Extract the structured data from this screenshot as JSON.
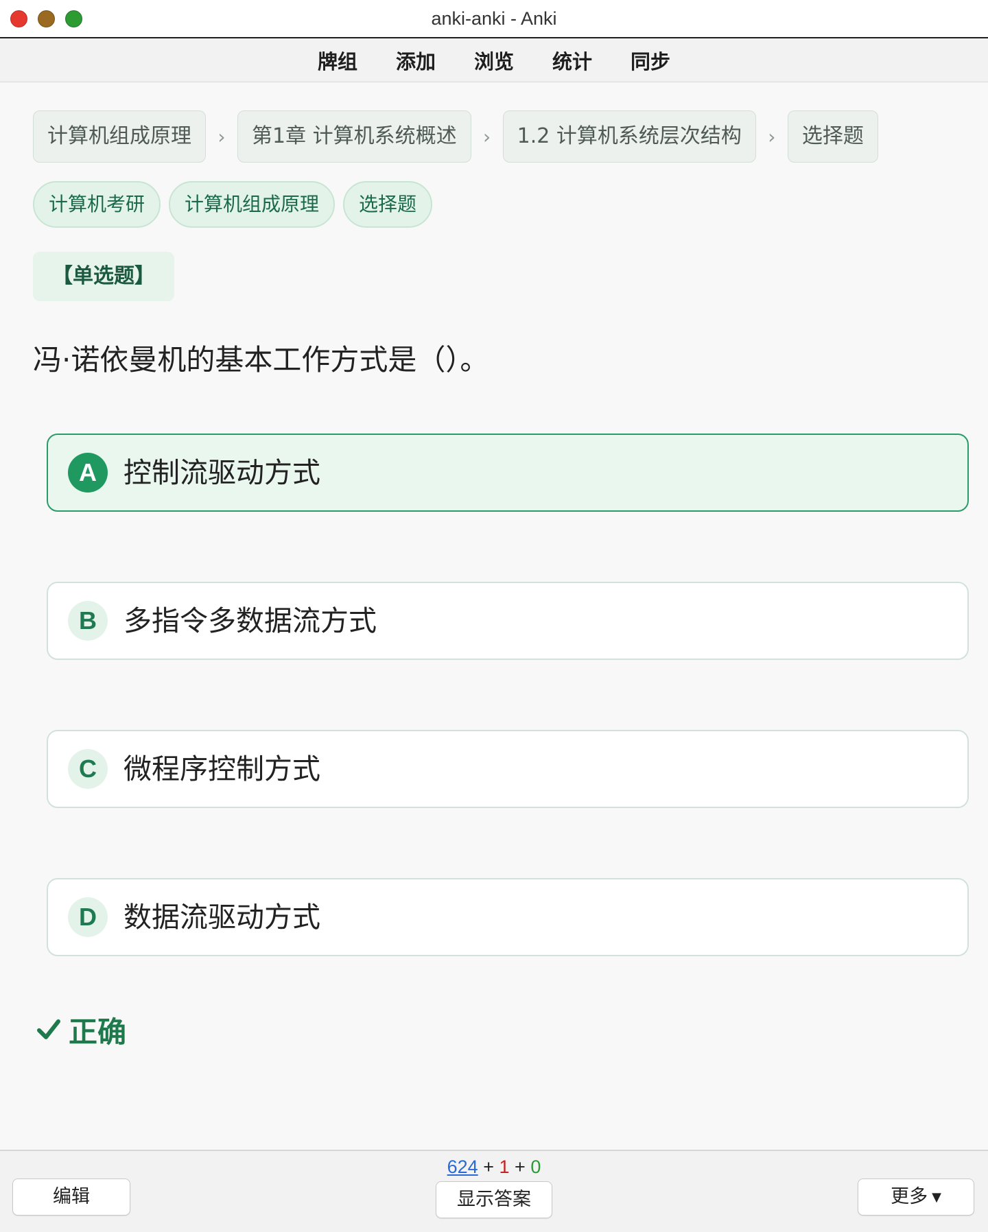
{
  "window": {
    "title": "anki-anki - Anki"
  },
  "nav": {
    "items": [
      "牌组",
      "添加",
      "浏览",
      "统计",
      "同步"
    ]
  },
  "breadcrumb": {
    "items": [
      "计算机组成原理",
      "第1章 计算机系统概述",
      "1.2 计算机系统层次结构",
      "选择题"
    ],
    "separator": "›"
  },
  "tags": [
    "计算机考研",
    "计算机组成原理",
    "选择题"
  ],
  "question": {
    "type_label": "【单选题】",
    "text": "冯·诺依曼机的基本工作方式是（）。"
  },
  "options": [
    {
      "letter": "A",
      "text": "控制流驱动方式",
      "selected": true
    },
    {
      "letter": "B",
      "text": "多指令多数据流方式",
      "selected": false
    },
    {
      "letter": "C",
      "text": "微程序控制方式",
      "selected": false
    },
    {
      "letter": "D",
      "text": "数据流驱动方式",
      "selected": false
    }
  ],
  "result": {
    "text": "正确",
    "icon": "check-icon",
    "color": "#1e7a4d"
  },
  "bottom": {
    "edit_label": "编辑",
    "show_answer_label": "显示答案",
    "more_label": "更多",
    "counts": {
      "new": "624",
      "plus1": "+",
      "learn": "1",
      "plus2": "+",
      "review": "0"
    }
  },
  "colors": {
    "accent": "#1f9960",
    "new": "#2a6ad6",
    "learn": "#c8201e",
    "review": "#2c9a33"
  }
}
